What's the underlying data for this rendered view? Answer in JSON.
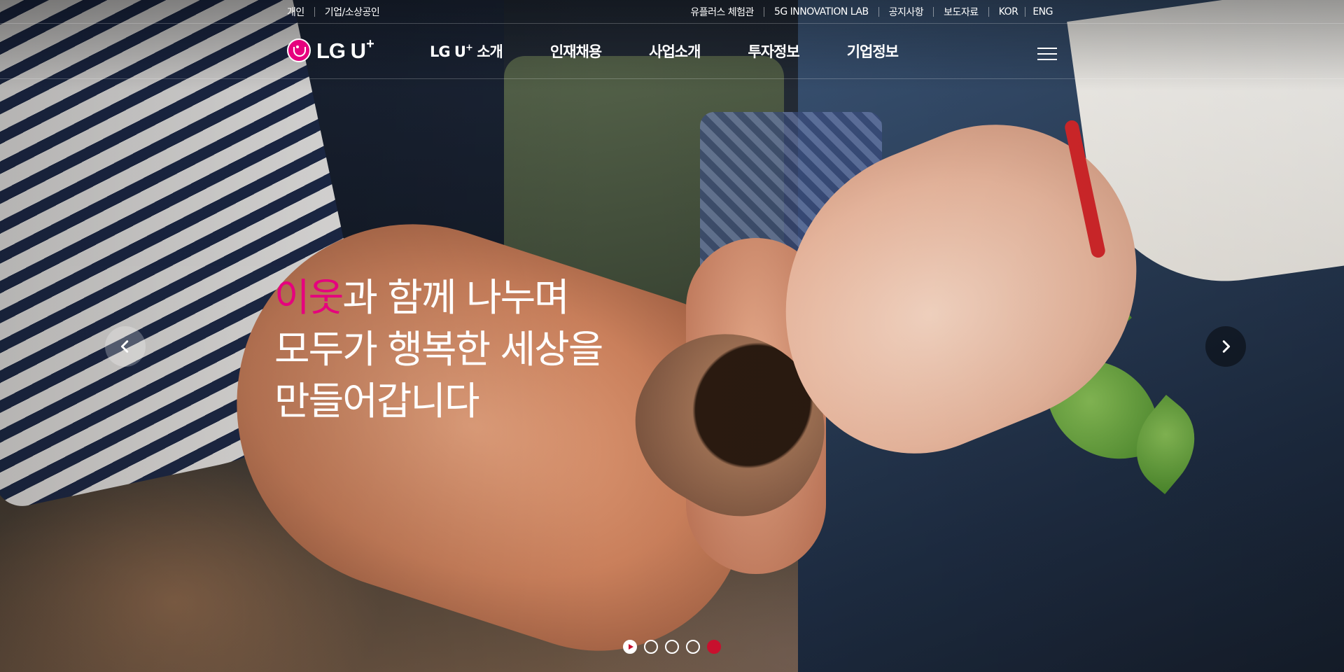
{
  "util": {
    "left_links": [
      "개인",
      "기업/소상공인"
    ],
    "right_links": [
      "유플러스 체험관",
      "5G INNOVATION LAB",
      "공지사항",
      "보도자료"
    ],
    "lang": [
      "KOR",
      "ENG"
    ]
  },
  "logo": {
    "text": "LG U",
    "sup": "+"
  },
  "nav": {
    "items": [
      {
        "label": "LG U",
        "sup": "+",
        "suffix": " 소개"
      },
      {
        "label": "인재채용"
      },
      {
        "label": "사업소개"
      },
      {
        "label": "투자정보"
      },
      {
        "label": "기업정보"
      }
    ]
  },
  "hero": {
    "accent": "이웃",
    "line1_rest": "과 함께 나누며",
    "line2": "모두가 행복한 세상을",
    "line3": "만들어갑니다"
  },
  "pager": {
    "count": 5,
    "active_index": 4
  },
  "colors": {
    "brand": "#e6007e",
    "active_dot": "#c8102e"
  },
  "icons": [
    "logo-mark-icon",
    "hamburger-menu-icon",
    "chevron-left-icon",
    "chevron-right-icon",
    "play-icon"
  ]
}
